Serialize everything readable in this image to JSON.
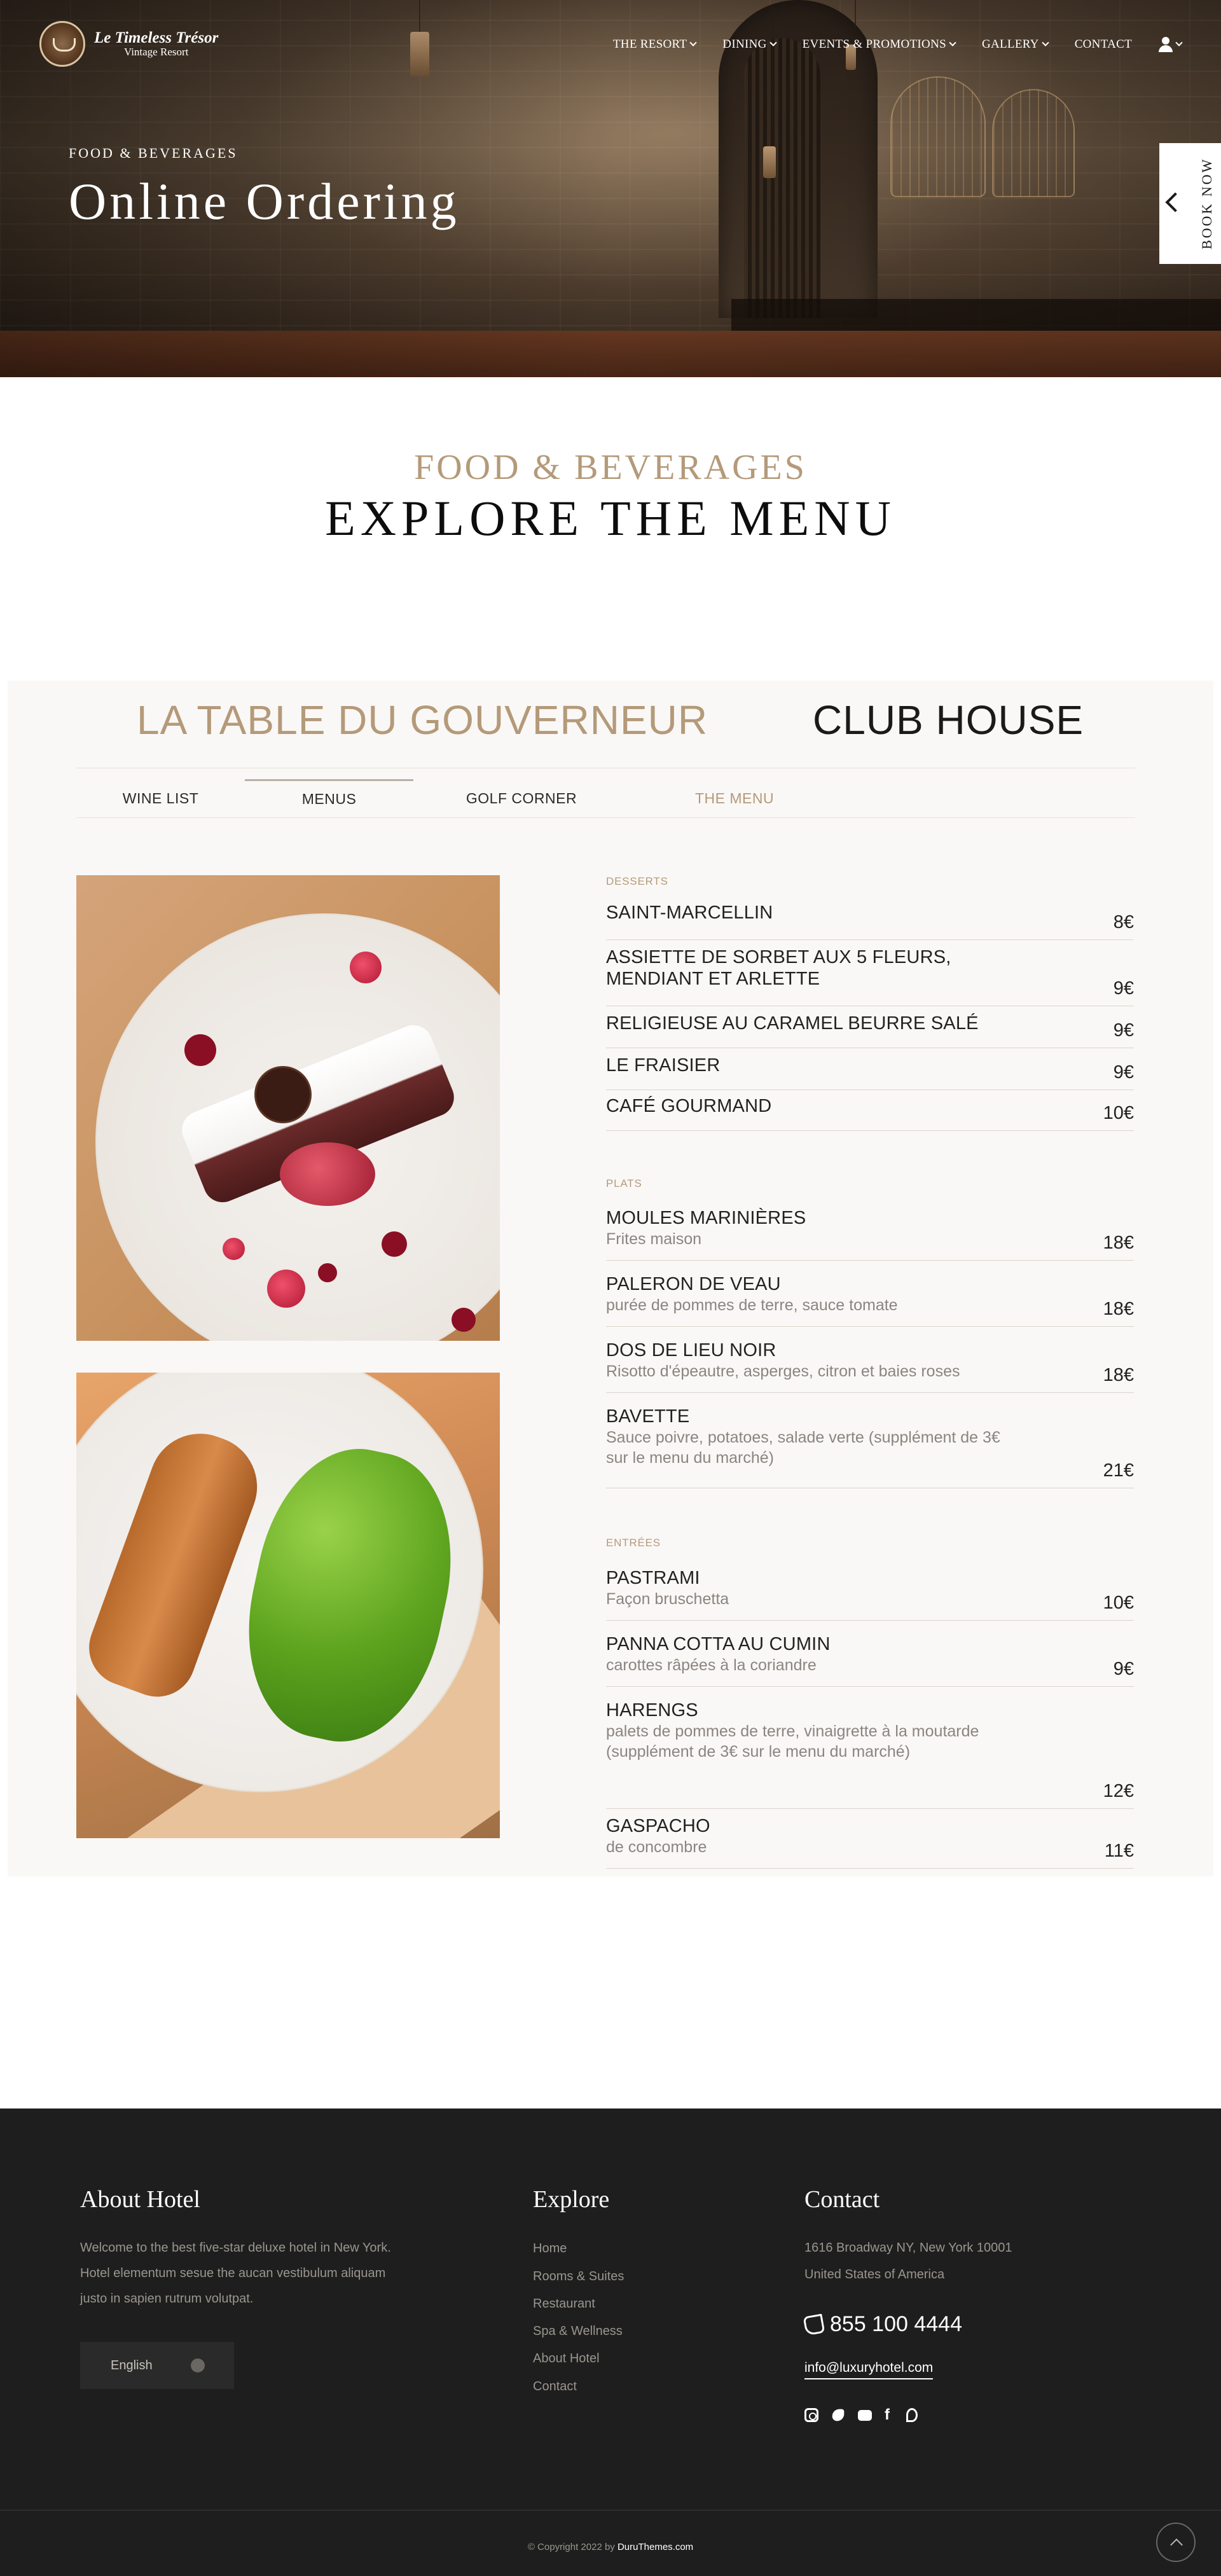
{
  "header": {
    "logo_name": "Le Timeless Trésor",
    "logo_sub": "Vintage Resort",
    "nav": [
      {
        "label": "THE RESORT",
        "dropdown": true
      },
      {
        "label": "DINING",
        "dropdown": true
      },
      {
        "label": "EVENTS & PROMOTIONS",
        "dropdown": true
      },
      {
        "label": "GALLERY",
        "dropdown": true
      },
      {
        "label": "CONTACT",
        "dropdown": false
      }
    ],
    "account_icon": "user-icon"
  },
  "hero": {
    "kicker": "FOOD & BEVERAGES",
    "title": "Online Ordering",
    "book_now": "BOOK NOW"
  },
  "section": {
    "kicker": "FOOD & BEVERAGES",
    "title": "EXPLORE THE MENU"
  },
  "tabs": {
    "venues": [
      "LA TABLE DU GOUVERNEUR",
      "CLUB HOUSE"
    ],
    "subtabs": [
      "WINE LIST",
      "MENUS",
      "GOLF CORNER",
      "THE MENU"
    ]
  },
  "menu": {
    "categories": [
      {
        "name": "DESSERTS",
        "items": [
          {
            "name": "SAINT-MARCELLIN",
            "desc": "",
            "price": "8€"
          },
          {
            "name": "ASSIETTE DE SORBET AUX 5 FLEURS, MENDIANT ET ARLETTE",
            "desc": "",
            "price": "9€"
          },
          {
            "name": "RELIGIEUSE AU CARAMEL BEURRE SALÉ",
            "desc": "",
            "price": "9€"
          },
          {
            "name": "LE FRAISIER",
            "desc": "",
            "price": "9€"
          },
          {
            "name": "CAFÉ GOURMAND",
            "desc": "",
            "price": "10€"
          }
        ]
      },
      {
        "name": "PLATS",
        "items": [
          {
            "name": "MOULES MARINIÈRES",
            "desc": "Frites maison",
            "price": "18€"
          },
          {
            "name": "PALERON DE VEAU",
            "desc": "purée de pommes de terre, sauce tomate",
            "price": "18€"
          },
          {
            "name": "DOS DE LIEU NOIR",
            "desc": "Risotto d'épeautre, asperges, citron et baies roses",
            "price": "18€"
          },
          {
            "name": "BAVETTE",
            "desc": "Sauce poivre, potatoes, salade verte (supplément de 3€ sur le menu du marché)",
            "price": "21€"
          }
        ]
      },
      {
        "name": "ENTRÉES",
        "items": [
          {
            "name": "PASTRAMI",
            "desc": "Façon bruschetta",
            "price": "10€"
          },
          {
            "name": "PANNA COTTA AU CUMIN",
            "desc": "carottes râpées à la coriandre",
            "price": "9€"
          },
          {
            "name": "HARENGS",
            "desc": "palets de pommes de terre, vinaigrette à la moutarde (supplément de 3€ sur le menu du marché)",
            "price": "12€"
          },
          {
            "name": "GASPACHO",
            "desc": "de concombre",
            "price": "11€"
          }
        ]
      }
    ]
  },
  "footer": {
    "about_title": "About Hotel",
    "about_text": "Welcome to the best five-star deluxe hotel in New York. Hotel elementum sesue the aucan vestibulum aliquam justo in sapien rutrum volutpat.",
    "language": "English",
    "explore_title": "Explore",
    "explore_links": [
      "Home",
      "Rooms & Suites",
      "Restaurant",
      "Spa & Wellness",
      "About Hotel",
      "Contact"
    ],
    "contact_title": "Contact",
    "address_line1": "1616 Broadway NY, New York 10001",
    "address_line2": "United States of America",
    "phone": "855 100 4444",
    "email": "info@luxuryhotel.com",
    "socials": [
      "instagram-icon",
      "twitter-icon",
      "youtube-icon",
      "facebook-icon",
      "pinterest-icon"
    ],
    "copyright": "© Copyright 2022 by",
    "copyright_brand": "DuruThemes.com"
  }
}
